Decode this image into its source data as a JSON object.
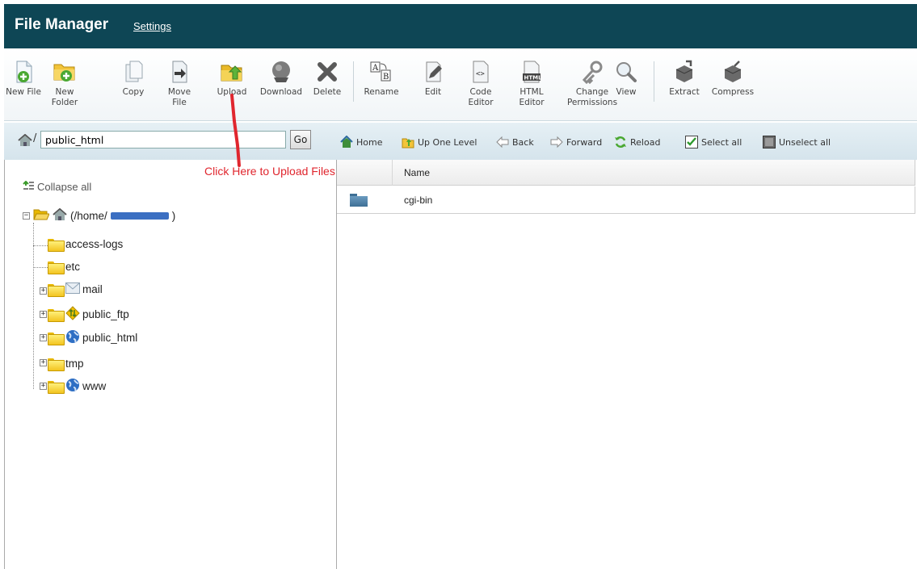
{
  "header": {
    "title": "File Manager",
    "settings_link": "Settings",
    "bg_color": "#0e4655"
  },
  "toolbar": {
    "items": [
      {
        "label": "New File",
        "icon": "new-file-icon"
      },
      {
        "label": "New\nFolder",
        "icon": "new-folder-icon"
      },
      {
        "label": "Copy",
        "icon": "copy-icon"
      },
      {
        "label": "Move\nFile",
        "icon": "move-file-icon"
      },
      {
        "label": "Upload",
        "icon": "upload-icon"
      },
      {
        "label": "Download",
        "icon": "download-icon"
      },
      {
        "label": "Delete",
        "icon": "delete-icon"
      },
      {
        "label": "Rename",
        "icon": "rename-icon"
      },
      {
        "label": "Edit",
        "icon": "edit-icon"
      },
      {
        "label": "Code\nEditor",
        "icon": "code-editor-icon"
      },
      {
        "label": "HTML\nEditor",
        "icon": "html-editor-icon"
      },
      {
        "label": "Change\nPermissions",
        "icon": "permissions-icon"
      },
      {
        "label": "View",
        "icon": "view-icon"
      },
      {
        "label": "Extract",
        "icon": "extract-icon"
      },
      {
        "label": "Compress",
        "icon": "compress-icon"
      }
    ],
    "html_icon_text": "HTML",
    "code_icon_text": "<>"
  },
  "path": {
    "prefix": "/",
    "value": "public_html",
    "go_label": "Go"
  },
  "nav": {
    "home": "Home",
    "up": "Up One Level",
    "back": "Back",
    "forward": "Forward",
    "reload": "Reload",
    "select_all": "Select all",
    "unselect_all": "Unselect all"
  },
  "tree": {
    "collapse_label": "Collapse all",
    "root_prefix": "(/home/",
    "root_suffix": ")",
    "items": [
      "access-logs",
      "etc",
      "mail",
      "public_ftp",
      "public_html",
      "tmp",
      "www"
    ]
  },
  "files": {
    "column_name": "Name",
    "rows": [
      {
        "name": "cgi-bin",
        "type": "folder"
      }
    ]
  },
  "annotation": {
    "text": "Click Here to Upload Files",
    "color": "#e0262e"
  }
}
